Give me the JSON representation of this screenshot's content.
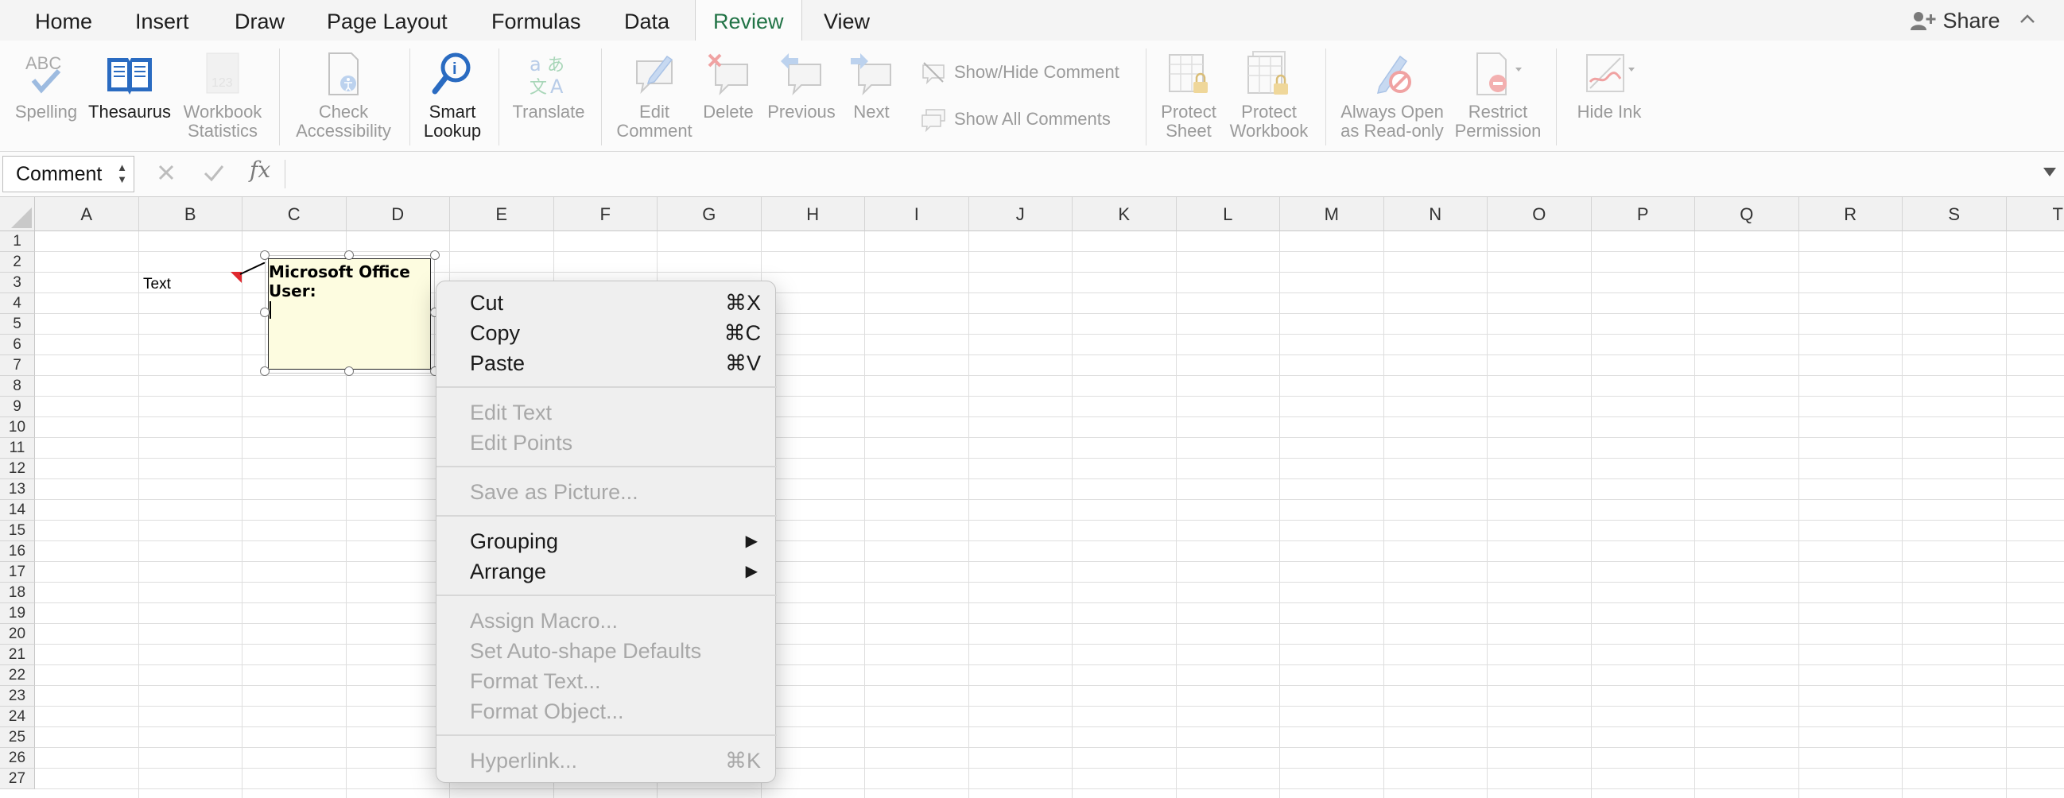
{
  "tabs": [
    "Home",
    "Insert",
    "Draw",
    "Page Layout",
    "Formulas",
    "Data",
    "Review",
    "View"
  ],
  "active_tab": "Review",
  "share_label": "Share",
  "ribbon": {
    "spelling": "Spelling",
    "thesaurus": "Thesaurus",
    "workbook_statistics": [
      "Workbook",
      "Statistics"
    ],
    "check_accessibility": [
      "Check",
      "Accessibility"
    ],
    "smart_lookup": [
      "Smart",
      "Lookup"
    ],
    "translate": "Translate",
    "edit_comment": [
      "Edit",
      "Comment"
    ],
    "delete": "Delete",
    "previous": "Previous",
    "next": "Next",
    "show_hide_comment": "Show/Hide Comment",
    "show_all_comments": "Show All Comments",
    "protect_sheet": [
      "Protect",
      "Sheet"
    ],
    "protect_workbook": [
      "Protect",
      "Workbook"
    ],
    "always_open_read_only": [
      "Always Open",
      "as Read-only"
    ],
    "restrict_permission": [
      "Restrict",
      "Permission"
    ],
    "hide_ink": "Hide Ink"
  },
  "formula_bar": {
    "name_box": "Comment",
    "fx": "fx",
    "value": ""
  },
  "columns": [
    "A",
    "B",
    "C",
    "D",
    "E",
    "F",
    "G",
    "H",
    "I",
    "J",
    "K",
    "L",
    "M",
    "N",
    "O",
    "P",
    "Q",
    "R",
    "S",
    "T"
  ],
  "rows": [
    "1",
    "2",
    "3",
    "4",
    "5",
    "6",
    "7",
    "8",
    "9",
    "10",
    "11",
    "12",
    "13",
    "14",
    "15",
    "16",
    "17",
    "18",
    "19",
    "20",
    "21",
    "22",
    "23",
    "24",
    "25",
    "26",
    "27"
  ],
  "cells": {
    "B3": "Text"
  },
  "comment": {
    "author": "Microsoft Office User:",
    "author_line1": "Microsoft Office",
    "author_line2": "User:",
    "body": ""
  },
  "context_menu": {
    "cut": {
      "label": "Cut",
      "shortcut": "⌘X"
    },
    "copy": {
      "label": "Copy",
      "shortcut": "⌘C"
    },
    "paste": {
      "label": "Paste",
      "shortcut": "⌘V"
    },
    "edit_text": {
      "label": "Edit Text"
    },
    "edit_points": {
      "label": "Edit Points"
    },
    "save_as_picture": {
      "label": "Save as Picture..."
    },
    "grouping": {
      "label": "Grouping",
      "arrow": "▶"
    },
    "arrange": {
      "label": "Arrange",
      "arrow": "▶"
    },
    "assign_macro": {
      "label": "Assign Macro..."
    },
    "set_autoshape_defaults": {
      "label": "Set Auto-shape Defaults"
    },
    "format_text": {
      "label": "Format Text..."
    },
    "format_object": {
      "label": "Format Object..."
    },
    "hyperlink": {
      "label": "Hyperlink...",
      "shortcut": "⌘K"
    }
  },
  "colors": {
    "accent": "#217346",
    "comment_bg": "#fdfce0",
    "comment_indicator": "#e0292f",
    "disabled_text": "#a8a8a8"
  }
}
